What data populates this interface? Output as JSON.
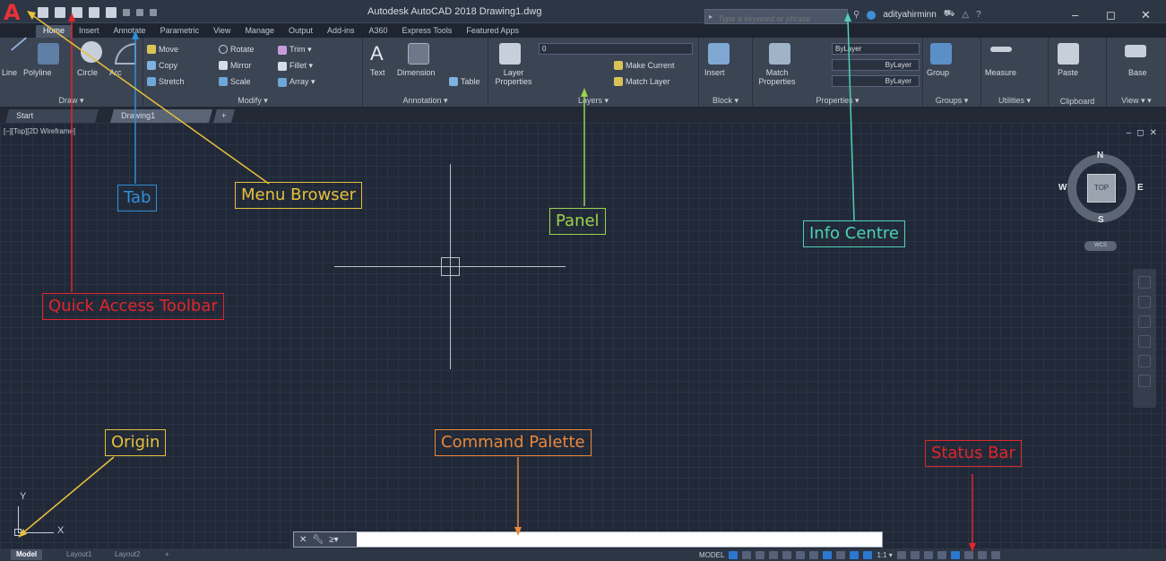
{
  "app": {
    "logo": "A",
    "title": "Autodesk AutoCAD 2018   Drawing1.dwg",
    "search_placeholder": "Type a keyword or phrase",
    "username": "adityahirminn",
    "window_controls": [
      "–",
      "◻",
      "✕"
    ]
  },
  "ribbon_tabs": [
    "Home",
    "Insert",
    "Annotate",
    "Parametric",
    "View",
    "Manage",
    "Output",
    "Add-ins",
    "A360",
    "Express Tools",
    "Featured Apps"
  ],
  "ribbon": {
    "draw": {
      "title": "Draw ▾",
      "line": "Line",
      "polyline": "Polyline",
      "circle": "Circle",
      "arc": "Arc"
    },
    "modify": {
      "title": "Modify ▾",
      "move": "Move",
      "rotate": "Rotate",
      "trim": "Trim ▾",
      "copy": "Copy",
      "mirror": "Mirror",
      "fillet": "Fillet ▾",
      "stretch": "Stretch",
      "scale": "Scale",
      "array": "Array ▾"
    },
    "annotation": {
      "title": "Annotation ▾",
      "text": "Text",
      "dimension": "Dimension",
      "table": "Table"
    },
    "layers": {
      "title": "Layers ▾",
      "layer_properties": "Layer Properties",
      "make_current": "Make Current",
      "match_layer": "Match Layer",
      "layer_value": "0"
    },
    "block": {
      "title": "Block ▾",
      "insert": "Insert"
    },
    "properties": {
      "title": "Properties ▾",
      "match_properties": "Match Properties",
      "bylayer_1": "ByLayer",
      "bylayer_2": "ByLayer",
      "bylayer_3": "ByLayer"
    },
    "groups": {
      "title": "Groups ▾",
      "group": "Group"
    },
    "utilities": {
      "title": "Utilities ▾",
      "measure": "Measure"
    },
    "clipboard": {
      "title": "Clipboard",
      "paste": "Paste"
    },
    "view": {
      "title": "View ▾ ▾",
      "base": "Base"
    }
  },
  "file_tabs": {
    "start": "Start",
    "drawing": "Drawing1",
    "plus": "+"
  },
  "viewport": {
    "label": "[–][Top][2D Wireframe]",
    "controls": [
      "–",
      "◻",
      "✕"
    ]
  },
  "viewcube": {
    "north": "N",
    "south": "S",
    "east": "E",
    "west": "W",
    "face": "TOP",
    "wcs": "WCS"
  },
  "ucs": {
    "x": "X",
    "y": "Y"
  },
  "command_line": {
    "placeholder": "",
    "prompt_icon": "≥▾"
  },
  "layout_tabs": [
    "Model",
    "Layout1",
    "Layout2",
    "+"
  ],
  "status_bar": {
    "model": "MODEL",
    "scale": "1:1 ▾"
  },
  "annotations": {
    "tab": "Tab",
    "menu_browser": "Menu Browser",
    "panel": "Panel",
    "info_centre": "Info Centre",
    "quick_access_toolbar": "Quick Access Toolbar",
    "origin": "Origin",
    "command_palette": "Command Palette",
    "status_bar": "Status Bar"
  },
  "colors": {
    "annot_red": "#e0262b",
    "annot_blue": "#2f8fd8",
    "annot_yellow": "#e6c03a",
    "annot_green": "#9bd24a",
    "annot_teal": "#4fd1b5",
    "annot_orange": "#e8873a"
  }
}
